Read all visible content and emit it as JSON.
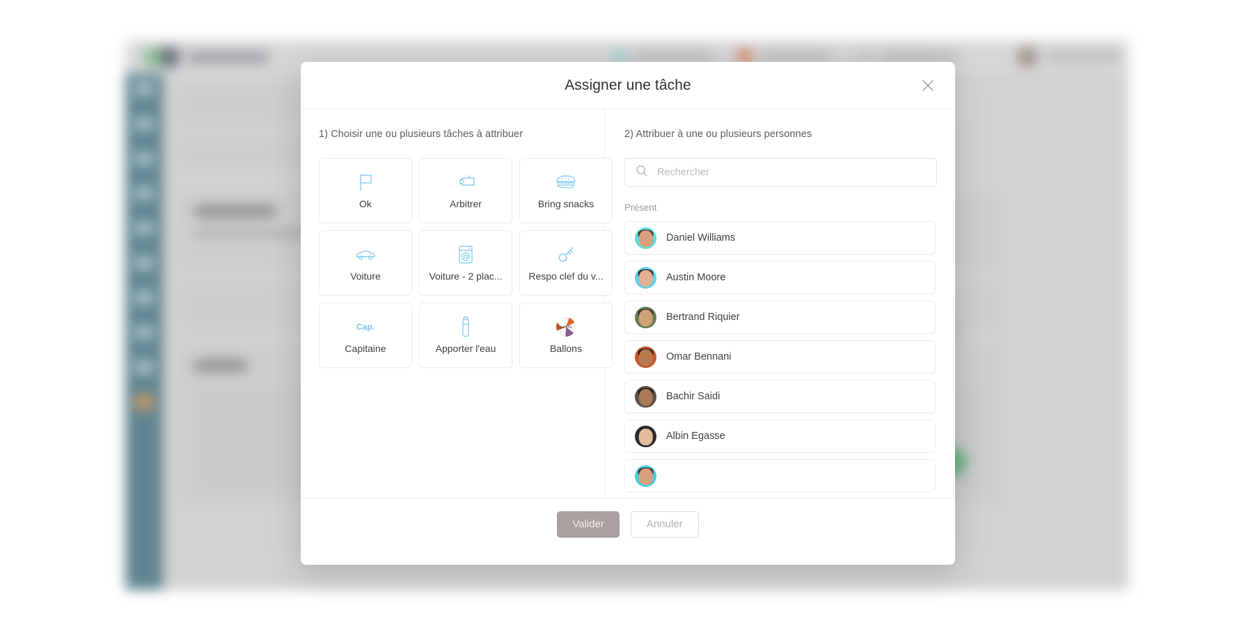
{
  "modal": {
    "title": "Assigner une tâche",
    "close_icon": "close-icon",
    "step1_label": "1) Choisir une ou plusieurs tâches à attribuer",
    "step2_label": "2) Attribuer à une ou plusieurs personnes",
    "search": {
      "placeholder": "Rechercher",
      "value": "",
      "icon": "search-icon"
    },
    "group_label": "Présent",
    "tasks": [
      {
        "label": "Ok",
        "icon": "flag-icon"
      },
      {
        "label": "Arbitrer",
        "icon": "whistle-icon"
      },
      {
        "label": "Bring snacks",
        "icon": "sandwich-icon"
      },
      {
        "label": "Voiture",
        "icon": "car-icon"
      },
      {
        "label": "Voiture - 2 plac...",
        "icon": "washing-machine-icon"
      },
      {
        "label": "Respo clef du v...",
        "icon": "key-icon"
      },
      {
        "label": "Capitaine",
        "icon": "captain-badge-icon",
        "badge_text": "Cap."
      },
      {
        "label": "Apporter l'eau",
        "icon": "water-bottle-icon"
      },
      {
        "label": "Ballons",
        "icon": "ball-photo-icon"
      }
    ],
    "people": [
      {
        "name": "Daniel Williams",
        "avatar_bg": "#63dce0",
        "hair": "#4a3a2e",
        "skin": "#d8a07c"
      },
      {
        "name": "Austin Moore",
        "avatar_bg": "#5fd2ef",
        "hair": "#2e2a26",
        "skin": "#e2b191"
      },
      {
        "name": "Bertrand Riquier",
        "avatar_bg": "#6d7a52",
        "hair": "#3a3128",
        "skin": "#cfa17b"
      },
      {
        "name": "Omar Bennani",
        "avatar_bg": "#c9572c",
        "hair": "#241f1c",
        "skin": "#b8794f"
      },
      {
        "name": "Bachir Saidi",
        "avatar_bg": "#5a5148",
        "hair": "#1f1b18",
        "skin": "#a97a55"
      },
      {
        "name": "Albin Egasse",
        "avatar_bg": "#2b2b2f",
        "hair": "#2b2b2f",
        "skin": "#e3bb9a"
      },
      {
        "name": "",
        "avatar_bg": "#4fc9dc",
        "hair": "#3a332c",
        "skin": "#d8a07c"
      }
    ],
    "footer": {
      "validate_label": "Valider",
      "cancel_label": "Annuler"
    }
  },
  "colors": {
    "accent_icon": "#8ecdf0",
    "sidebar": "#3e6a78",
    "green_button": "#3ea05e",
    "primary_button": "#a9a09f",
    "title_text": "#2f3033"
  }
}
